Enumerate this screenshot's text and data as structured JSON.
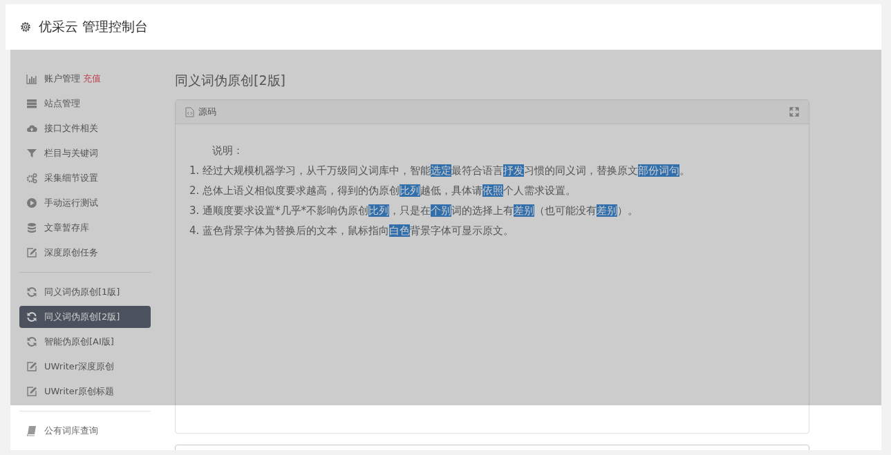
{
  "header": {
    "title": "优采云 管理控制台"
  },
  "sidebar": {
    "groups": [
      {
        "items": [
          {
            "kind": "bars",
            "label": "账户管理",
            "badge": "充值",
            "selected": false
          },
          {
            "kind": "server",
            "label": "站点管理",
            "selected": false
          },
          {
            "kind": "cloud",
            "label": "接口文件相关",
            "selected": false
          },
          {
            "kind": "filter",
            "label": "栏目与关键词",
            "selected": false
          },
          {
            "kind": "gears",
            "label": "采集细节设置",
            "selected": false
          },
          {
            "kind": "play",
            "label": "手动运行测试",
            "selected": false
          },
          {
            "kind": "database",
            "label": "文章暂存库",
            "selected": false
          },
          {
            "kind": "edit",
            "label": "深度原创任务",
            "selected": false
          }
        ]
      },
      {
        "items": [
          {
            "kind": "refresh",
            "label": "同义词伪原创[1版]",
            "selected": false
          },
          {
            "kind": "refresh",
            "label": "同义词伪原创[2版]",
            "selected": true
          },
          {
            "kind": "refresh",
            "label": "智能伪原创[AI版]",
            "selected": false
          },
          {
            "kind": "edit",
            "label": "UWriter深度原创",
            "selected": false
          },
          {
            "kind": "edit",
            "label": "UWriter原创标题",
            "selected": false
          }
        ]
      },
      {
        "items": [
          {
            "kind": "book",
            "label": "公有词库查询",
            "selected": false
          }
        ]
      }
    ]
  },
  "page_title": "同义词伪原创[2版]",
  "panel": {
    "title": "源码",
    "intro": "说明：",
    "lines": [
      {
        "number": "1.",
        "segments": [
          {
            "text": "经过大规模机器学习，从千万级同义词库中，智能",
            "highlighted": false
          },
          {
            "text": "选定",
            "highlighted": true
          },
          {
            "text": "最符合语言",
            "highlighted": false
          },
          {
            "text": "抒发",
            "highlighted": true
          },
          {
            "text": "习惯的同义词，替换原文",
            "highlighted": false
          },
          {
            "text": "部份",
            "highlighted": true
          },
          {
            "text": "词句",
            "highlighted": true
          },
          {
            "text": "。",
            "highlighted": false
          }
        ]
      },
      {
        "number": "2.",
        "segments": [
          {
            "text": "总体上语义相似度要求越高，得到的伪原创",
            "highlighted": false
          },
          {
            "text": "比列",
            "highlighted": true
          },
          {
            "text": "越低，具体请",
            "highlighted": false
          },
          {
            "text": "依照",
            "highlighted": true
          },
          {
            "text": "个人需求设置。",
            "highlighted": false
          }
        ]
      },
      {
        "number": "3.",
        "segments": [
          {
            "text": "通顺度要求设置*几乎*不影响伪原创",
            "highlighted": false
          },
          {
            "text": "比列",
            "highlighted": true
          },
          {
            "text": "，只是在",
            "highlighted": false
          },
          {
            "text": "个别",
            "highlighted": true
          },
          {
            "text": "词的选择上有",
            "highlighted": false
          },
          {
            "text": "差别",
            "highlighted": true
          },
          {
            "text": "（也可能没有",
            "highlighted": false
          },
          {
            "text": "差别",
            "highlighted": true
          },
          {
            "text": "）。",
            "highlighted": false
          }
        ]
      },
      {
        "number": "4.",
        "segments": [
          {
            "text": "蓝色背景字体为替换后的文本，鼠标指向",
            "highlighted": false
          },
          {
            "text": "白色",
            "highlighted": true
          },
          {
            "text": "背景字体可显示原文。",
            "highlighted": false
          }
        ]
      }
    ]
  },
  "overlay": {
    "shown": true
  }
}
